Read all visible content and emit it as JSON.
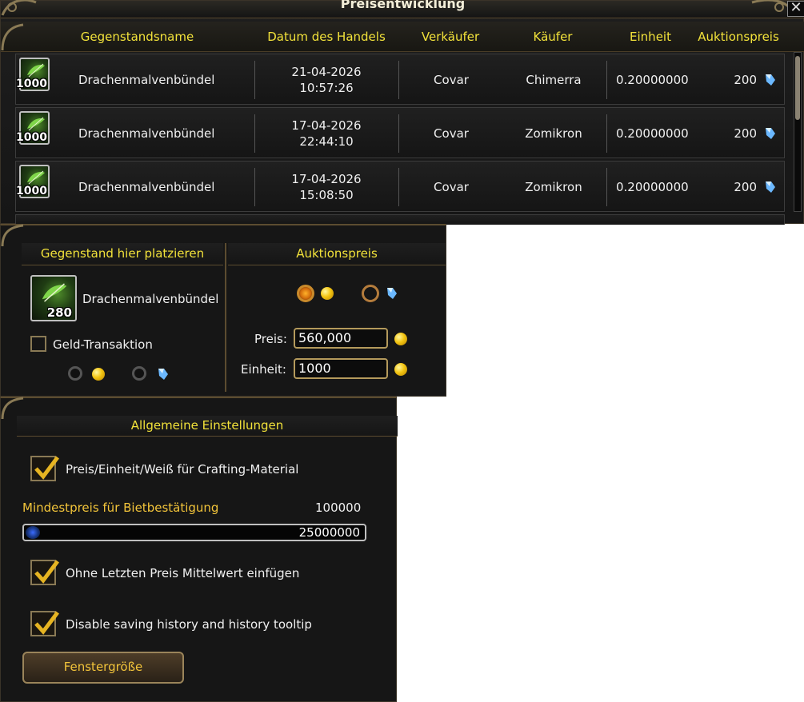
{
  "history": {
    "title": "Preisentwicklung",
    "headers": {
      "name": "Gegenstandsname",
      "date": "Datum des Handels",
      "seller": "Verkäufer",
      "buyer": "Käufer",
      "unit": "Einheit",
      "price": "Auktionspreis"
    },
    "rows": [
      {
        "qty": "1000",
        "name": "Drachenmalvenbündel",
        "date": "21-04-2026",
        "time": "10:57:26",
        "seller": "Covar",
        "buyer": "Chimerra",
        "unit": "0.20000000",
        "price": "200"
      },
      {
        "qty": "1000",
        "name": "Drachenmalvenbündel",
        "date": "17-04-2026",
        "time": "22:44:10",
        "seller": "Covar",
        "buyer": "Zomikron",
        "unit": "0.20000000",
        "price": "200"
      },
      {
        "qty": "1000",
        "name": "Drachenmalvenbündel",
        "date": "17-04-2026",
        "time": "15:08:50",
        "seller": "Covar",
        "buyer": "Zomikron",
        "unit": "0.20000000",
        "price": "200"
      }
    ]
  },
  "sell": {
    "place_item_header": "Gegenstand hier platzieren",
    "auction_price_header": "Auktionspreis",
    "item_qty": "280",
    "item_name": "Drachenmalvenbündel",
    "money_transaction_label": "Geld-Transaktion",
    "price_label": "Preis:",
    "price_value": "560,000",
    "unit_label": "Einheit:",
    "unit_value": "1000"
  },
  "settings": {
    "header": "Allgemeine Einstellungen",
    "option1": "Preis/Einheit/Weiß für Crafting-Material",
    "min_price_label": "Mindestpreis für Bietbestätigung",
    "min_price_value": "100000",
    "slider_value": "25000000",
    "option2": "Ohne Letzten Preis Mittelwert einfügen",
    "option3": "Disable saving history and history tooltip",
    "window_size_button": "Fenstergröße"
  },
  "colors": {
    "header_text": "#f2e23a",
    "item_name": "#39e33f",
    "button_text": "#f2c43a"
  }
}
